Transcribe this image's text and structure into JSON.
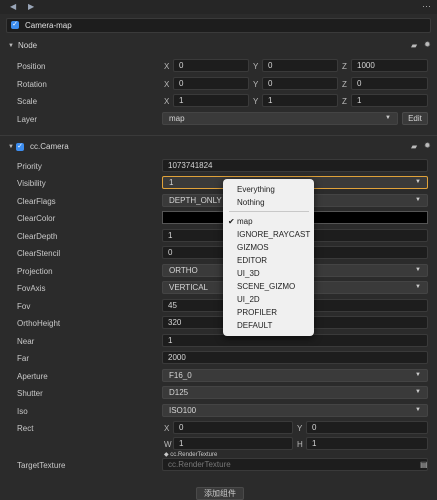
{
  "toolbar": {
    "back_icon": "◀",
    "forward_icon": "▶",
    "menu_icon": "⋯"
  },
  "node_name": "Camera-map",
  "node_section": {
    "title": "Node"
  },
  "position": {
    "label": "Position",
    "x": "0",
    "y": "0",
    "z": "1000"
  },
  "rotation": {
    "label": "Rotation",
    "x": "0",
    "y": "0",
    "z": "0"
  },
  "scale": {
    "label": "Scale",
    "x": "1",
    "y": "1",
    "z": "1"
  },
  "layer": {
    "label": "Layer",
    "value": "map",
    "edit_label": "Edit"
  },
  "camera_section": {
    "title": "cc.Camera"
  },
  "axes": {
    "x": "X",
    "y": "Y",
    "z": "Z",
    "w": "W",
    "h": "H"
  },
  "camera": {
    "priority": {
      "label": "Priority",
      "value": "1073741824"
    },
    "visibility": {
      "label": "Visibility",
      "value": "1"
    },
    "clear_flags": {
      "label": "ClearFlags",
      "value": "DEPTH_ONLY"
    },
    "clear_color": {
      "label": "ClearColor",
      "color": "#000000"
    },
    "clear_depth": {
      "label": "ClearDepth",
      "value": "1"
    },
    "clear_stencil": {
      "label": "ClearStencil",
      "value": "0"
    },
    "projection": {
      "label": "Projection",
      "value": "ORTHO"
    },
    "fov_axis": {
      "label": "FovAxis",
      "value": "VERTICAL"
    },
    "fov": {
      "label": "Fov",
      "value": "45"
    },
    "ortho_height": {
      "label": "OrthoHeight",
      "value": "320"
    },
    "near": {
      "label": "Near",
      "value": "1"
    },
    "far": {
      "label": "Far",
      "value": "2000"
    },
    "aperture": {
      "label": "Aperture",
      "value": "F16_0"
    },
    "shutter": {
      "label": "Shutter",
      "value": "D125"
    },
    "iso": {
      "label": "Iso",
      "value": "ISO100"
    },
    "rect": {
      "label": "Rect",
      "x": "0",
      "y": "0",
      "w": "1",
      "h": "1"
    },
    "target_texture": {
      "label": "TargetTexture",
      "type_tag": "cc.RenderTexture",
      "placeholder": "cc.RenderTexture"
    }
  },
  "visibility_dropdown": {
    "top_items": [
      "Everything",
      "Nothing"
    ],
    "checked_item": "map",
    "items": [
      "IGNORE_RAYCAST",
      "GIZMOS",
      "EDITOR",
      "UI_3D",
      "SCENE_GIZMO",
      "UI_2D",
      "PROFILER",
      "DEFAULT"
    ]
  },
  "add_component_label": "添加组件"
}
